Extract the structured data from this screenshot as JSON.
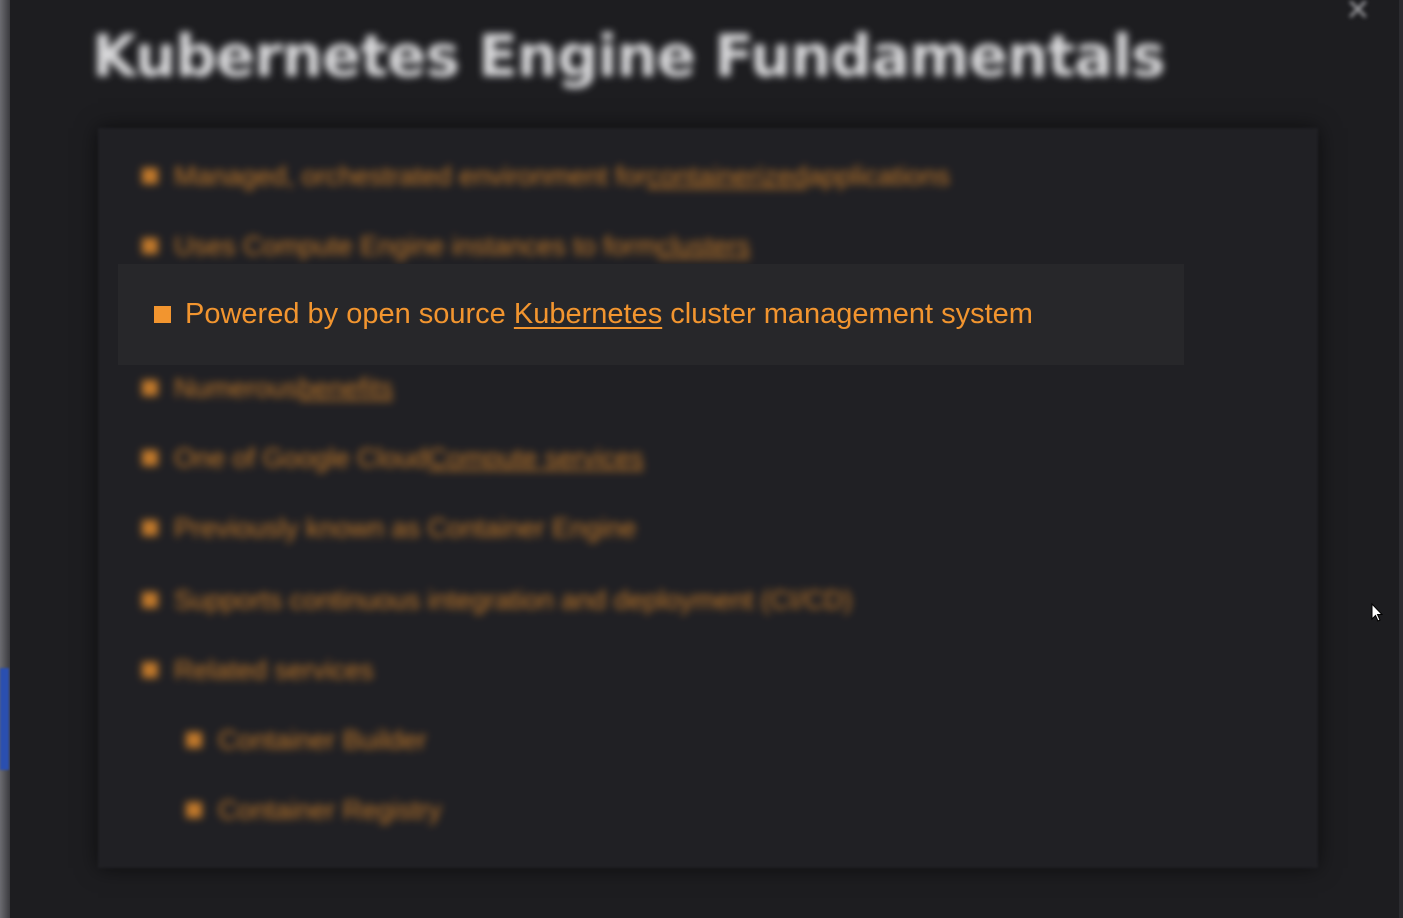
{
  "modal": {
    "title": "Kubernetes Engine Fundamentals",
    "close_icon": "close-icon"
  },
  "bullets": [
    {
      "pre": "Managed, orchestrated environment for ",
      "link": "containerized",
      "post": " applications"
    },
    {
      "pre": "Uses Compute Engine instances to form ",
      "link": "clusters",
      "post": ""
    },
    {
      "pre": "Powered by open source ",
      "link": "Kubernetes",
      "post": " cluster management system",
      "focused": true
    },
    {
      "pre": "Numerous ",
      "link": "benefits",
      "post": ""
    },
    {
      "pre": "One of Google Cloud ",
      "link": "Compute services",
      "post": ""
    },
    {
      "pre": "Previously known as Container Engine",
      "link": "",
      "post": ""
    },
    {
      "pre": "Supports continuous integration and deployment (CI/CD)",
      "link": "",
      "post": ""
    },
    {
      "pre": "Related services",
      "link": "",
      "post": ""
    }
  ],
  "sub_bullets": [
    {
      "text": "Container Builder"
    },
    {
      "text": "Container Registry"
    }
  ],
  "colors": {
    "accent": "#f2952f",
    "background": "#1d1d20",
    "focus_row": "#27272a"
  }
}
